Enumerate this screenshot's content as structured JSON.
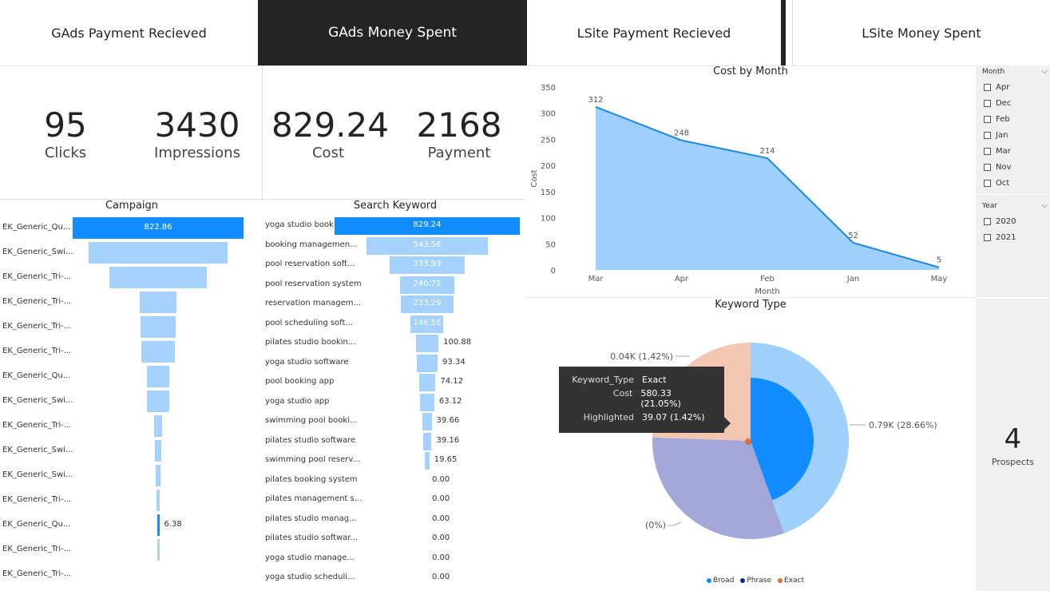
{
  "nav": {
    "back_icon": "←",
    "buttons": [
      {
        "label": "GAds Payment Recieved",
        "active": false
      },
      {
        "label": "GAds Money Spent",
        "active": true
      },
      {
        "label": "LSite Payment Recieved",
        "active": false
      },
      {
        "label": "LSite Money Spent",
        "active": false
      }
    ]
  },
  "kpis": [
    {
      "value": "95",
      "label": "Clicks"
    },
    {
      "value": "3430",
      "label": "Impressions"
    },
    {
      "value": "829.24",
      "label": "Cost"
    },
    {
      "value": "2168",
      "label": "Payment"
    }
  ],
  "campaign": {
    "title": "Campaign",
    "max": 822.86,
    "rows": [
      {
        "label": "EK_Generic_Qu...",
        "value": 822.86,
        "show": "822.86"
      },
      {
        "label": "EK_Generic_Swi...",
        "value": 670,
        "show": ""
      },
      {
        "label": "EK_Generic_Tri-...",
        "value": 470,
        "show": ""
      },
      {
        "label": "EK_Generic_Tri-...",
        "value": 180,
        "show": ""
      },
      {
        "label": "EK_Generic_Tri-...",
        "value": 170,
        "show": ""
      },
      {
        "label": "EK_Generic_Tri-...",
        "value": 165,
        "show": ""
      },
      {
        "label": "EK_Generic_Qu...",
        "value": 110,
        "show": ""
      },
      {
        "label": "EK_Generic_Swi...",
        "value": 105,
        "show": ""
      },
      {
        "label": "EK_Generic_Tri-...",
        "value": 42,
        "show": ""
      },
      {
        "label": "EK_Generic_Swi...",
        "value": 32,
        "show": ""
      },
      {
        "label": "EK_Generic_Swi...",
        "value": 22,
        "show": ""
      },
      {
        "label": "EK_Generic_Tri-...",
        "value": 12,
        "show": ""
      },
      {
        "label": "EK_Generic_Qu...",
        "value": 6.38,
        "show": "6.38"
      },
      {
        "label": "EK_Generic_Tri-...",
        "value": 3,
        "show": ""
      },
      {
        "label": "EK_Generic_Tri-...",
        "value": 0,
        "show": ""
      }
    ]
  },
  "keyword": {
    "title": "Search Keyword",
    "max": 829.24,
    "rows": [
      {
        "label": "yoga studio booking...",
        "value": 829.24,
        "show": "829.24"
      },
      {
        "label": "booking managemen...",
        "value": 543.56,
        "show": "543.56"
      },
      {
        "label": "pool reservation soft...",
        "value": 333.93,
        "show": "333.93"
      },
      {
        "label": "pool reservation system",
        "value": 240.72,
        "show": "240.72"
      },
      {
        "label": "reservation managem...",
        "value": 233.29,
        "show": "233.29"
      },
      {
        "label": "pool scheduling soft...",
        "value": 146.56,
        "show": "146.56"
      },
      {
        "label": "pilates studio bookin...",
        "value": 100.88,
        "show": "100.88"
      },
      {
        "label": "yoga studio software",
        "value": 93.34,
        "show": "93.34"
      },
      {
        "label": "pool booking app",
        "value": 74.12,
        "show": "74.12"
      },
      {
        "label": "yoga studio app",
        "value": 63.12,
        "show": "63.12"
      },
      {
        "label": "swimming pool booki...",
        "value": 39.66,
        "show": "39.66"
      },
      {
        "label": "pilates studio software",
        "value": 39.16,
        "show": "39.16"
      },
      {
        "label": "swimming pool reserv...",
        "value": 19.65,
        "show": "19.65"
      },
      {
        "label": "pilates booking system",
        "value": 0,
        "show": "0.00"
      },
      {
        "label": "pilates management s...",
        "value": 0,
        "show": "0.00"
      },
      {
        "label": "pilates studio manag...",
        "value": 0,
        "show": "0.00"
      },
      {
        "label": "pilates studio softwar...",
        "value": 0,
        "show": "0.00"
      },
      {
        "label": "yoga studio manage...",
        "value": 0,
        "show": "0.00"
      },
      {
        "label": "yoga studio scheduli...",
        "value": 0,
        "show": "0.00"
      }
    ]
  },
  "chart_data": [
    {
      "type": "area",
      "title": "Cost by Month",
      "xlabel": "Month",
      "ylabel": "Cost",
      "categories": [
        "Mar",
        "Apr",
        "Feb",
        "Jan",
        "May"
      ],
      "values": [
        312,
        248,
        214,
        52,
        5
      ],
      "ylim": [
        0,
        350
      ],
      "yticks": [
        0,
        50,
        100,
        150,
        200,
        250,
        300,
        350
      ],
      "grid": false,
      "color": "#1e88e5",
      "fill": "#9fd0fb"
    },
    {
      "type": "pie",
      "title": "Keyword Type",
      "legend": [
        "Broad",
        "Phrase",
        "Exact"
      ],
      "legend_colors": [
        "#118dff",
        "#12239e",
        "#e66c37"
      ],
      "slices": [
        {
          "name": "Broad",
          "value": 0.79,
          "share": 28.66,
          "label": "0.79K (28.66%)",
          "color": "#9fd0fb"
        },
        {
          "name": "Phrase",
          "value": 0.0,
          "share": 0,
          "label": "(0%)",
          "color": "#a3a8d8"
        },
        {
          "name": "Exact",
          "value": 0.04,
          "share": 1.42,
          "label": "0.04K (1.42%)",
          "color": "#f2c6b0"
        }
      ],
      "highlight": {
        "share": 35.0,
        "color": "#118dff"
      },
      "tooltip": {
        "rows": [
          {
            "k": "Keyword_Type",
            "v": "Exact"
          },
          {
            "k": "Cost",
            "v": "580.33 (21.05%)"
          },
          {
            "k": "Highlighted",
            "v": "39.07 (1.42%)"
          }
        ]
      }
    }
  ],
  "slicers": {
    "month": {
      "title": "Month",
      "items": [
        "Apr",
        "Dec",
        "Feb",
        "Jan",
        "Mar",
        "Nov",
        "Oct"
      ]
    },
    "year": {
      "title": "Year",
      "items": [
        "2020",
        "2021"
      ]
    }
  },
  "prospects": {
    "value": "4",
    "label": "Prospects"
  }
}
